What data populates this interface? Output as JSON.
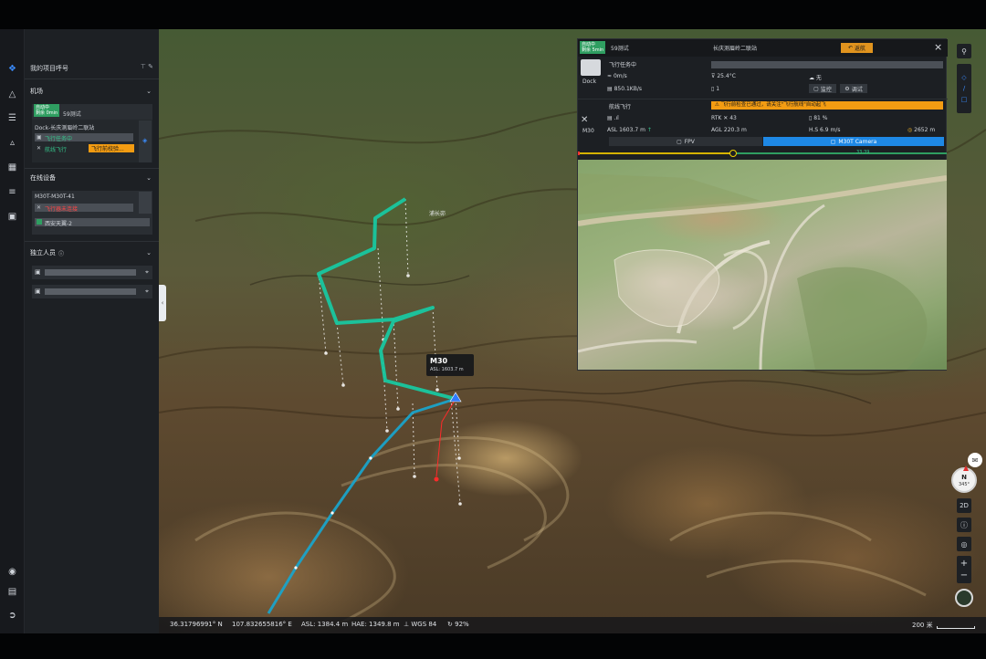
{
  "panel": {
    "title": "我的项目呼号",
    "sections": {
      "airport": "机场",
      "devices": "在线设备",
      "people": "独立人员"
    },
    "dock_card": {
      "status_pill": "自动中",
      "status_pill2": "剩余 0min",
      "name": "59测试",
      "dock_name": "Dock-长庆测眉岭二联站",
      "status": "飞行任务中",
      "state_left": "航线飞行",
      "state_warn": "飞行前校验..."
    },
    "device_card": {
      "name": "M30T-M30T-41",
      "alert": "飞行器未连接",
      "sub": "西安天翼-2"
    }
  },
  "popup": {
    "header_pill": "自动中",
    "header_pill2": "剩余 5min",
    "title": "59测试",
    "dock": "长庆测眉岭二联站",
    "return_btn": "返航",
    "close": "×",
    "dock_label": "Dock",
    "dock_status": "飞行任务中",
    "wind": "0m/s",
    "temp": "25.4°C",
    "rain": "无",
    "net": "850.1KB/s",
    "count": "1",
    "monitor_btn": "监控",
    "debug_btn": "调试",
    "aircraft_label": "M30",
    "aircraft_status": "航线飞行",
    "aircraft_warn": "飞行前检查已通过，请关注\"飞行航线\"自动起飞",
    "signal": ".ıl",
    "rtk": "RTK",
    "rtk_value": "43",
    "battery": "81 %",
    "asl": "ASL 1603.7 m",
    "agl": "AGL 220.3 m",
    "hs": "H.S 6.9 m/s",
    "distance": "2652 m",
    "tab_fpv": "FPV",
    "tab_camera": "M30T Camera",
    "timeline_value": "33:39"
  },
  "map": {
    "drone_label": "M30",
    "drone_asl": "ASL: 1603.7 m",
    "place_label": "浦长峁"
  },
  "controls": {
    "view_2d": "2D",
    "compass_n": "N",
    "compass_deg": "345°"
  },
  "bottom": {
    "lat": "36.31796991° N",
    "lon": "107.832655816° E",
    "asl": "ASL: 1384.4 m",
    "hae": "HAE: 1349.8 m",
    "datum": "WGS 84",
    "loading": "92%",
    "scale": "200 米"
  },
  "colors": {
    "route": "#18c7a0",
    "path_blue": "#1aa3c9",
    "accent": "#3b8cff",
    "warn": "#f39c12",
    "ok": "#2f9e61"
  }
}
